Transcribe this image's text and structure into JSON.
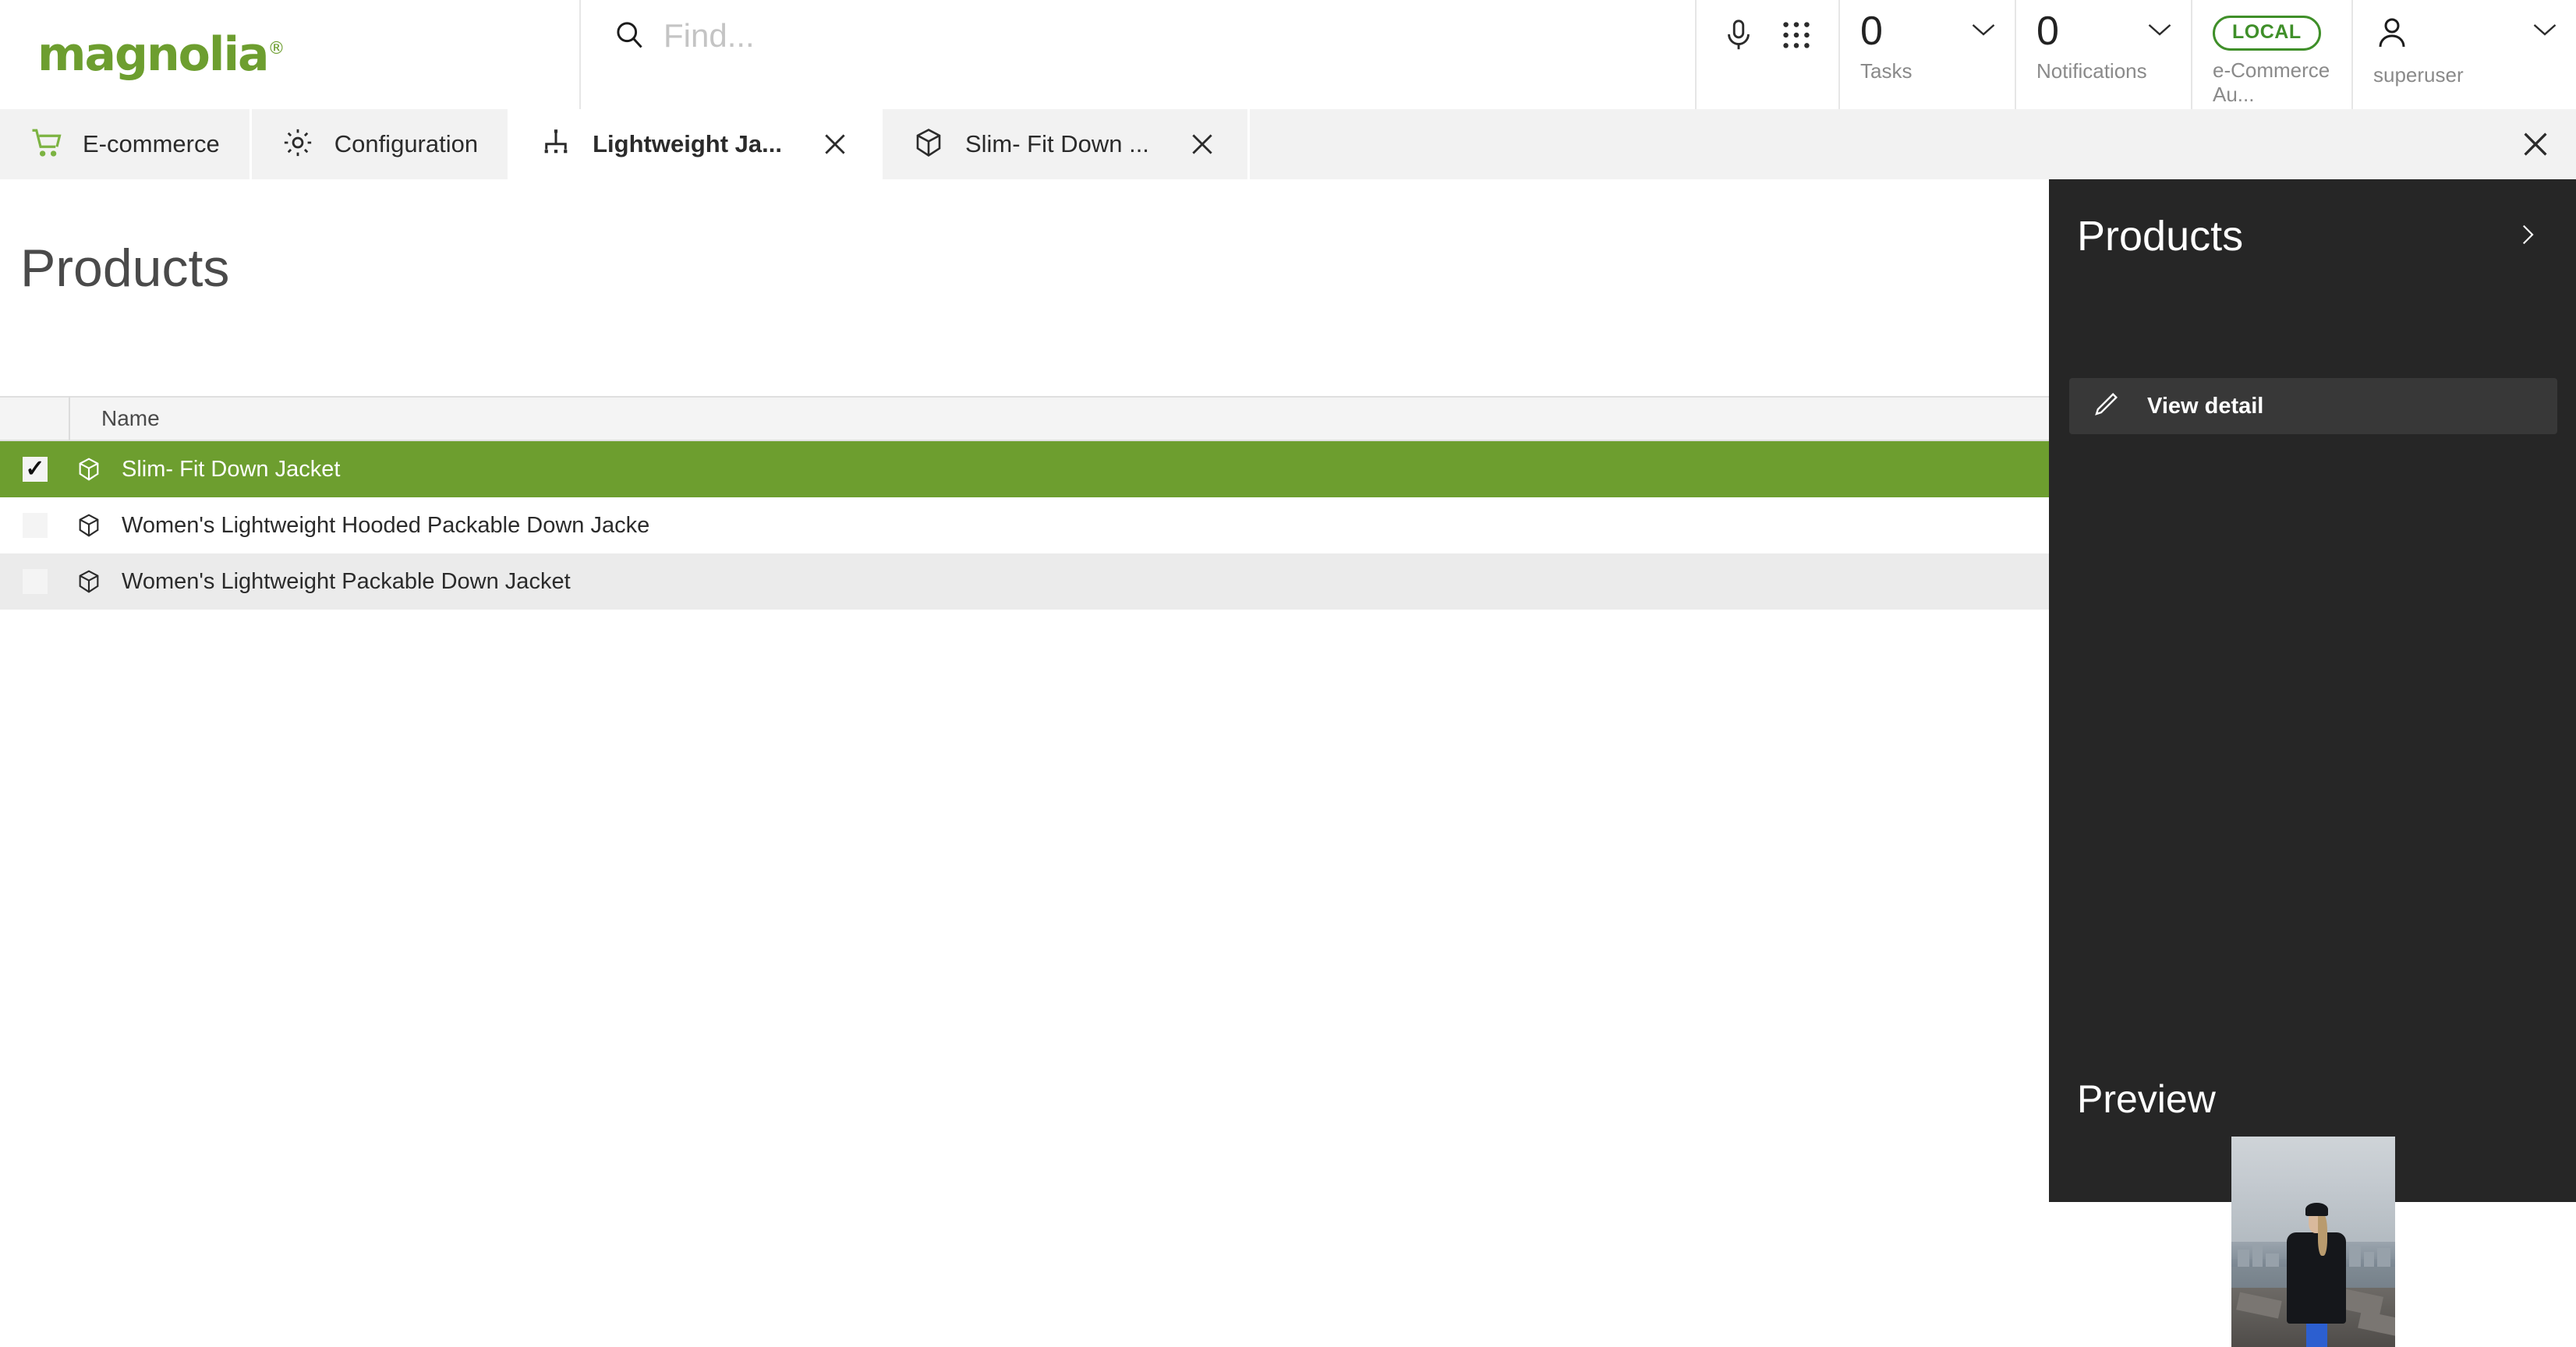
{
  "header": {
    "logo": {
      "text": "magnolia",
      "registered": "®",
      "color": "#6d9e2f"
    },
    "search": {
      "placeholder": "Find...",
      "value": "",
      "icon": "search-icon"
    },
    "icons": [
      {
        "name": "microphone-icon"
      },
      {
        "name": "apps-grid-icon"
      }
    ],
    "tasks": {
      "count": "0",
      "label": "Tasks"
    },
    "notifications": {
      "count": "0",
      "label": "Notifications"
    },
    "environment": {
      "badge": "LOCAL",
      "label": "e-Commerce Au...",
      "badge_color": "#3f8f29"
    },
    "user": {
      "name": "superuser",
      "icon": "user-icon"
    }
  },
  "tabs": {
    "items": [
      {
        "label": "E-commerce",
        "icon": "shopping-cart-icon",
        "active": false,
        "closable": false
      },
      {
        "label": "Configuration",
        "icon": "gear-icon",
        "active": false,
        "closable": false
      },
      {
        "label": "Lightweight Ja...",
        "icon": "hierarchy-icon",
        "active": true,
        "closable": true
      },
      {
        "label": "Slim- Fit Down ...",
        "icon": "cube-icon",
        "active": false,
        "closable": true
      }
    ],
    "close_all": "close-icon"
  },
  "main": {
    "title": "Products",
    "menu_button": "hamburger-menu-icon",
    "table": {
      "columns": [
        "Name"
      ],
      "rows": [
        {
          "name": "Slim- Fit Down Jacket",
          "icon": "cube-icon",
          "checked": true,
          "selected": true
        },
        {
          "name": "Women's Lightweight Hooded Packable Down Jacke",
          "icon": "cube-icon",
          "checked": false,
          "selected": false
        },
        {
          "name": "Women's Lightweight Packable Down Jacket",
          "icon": "cube-icon",
          "checked": false,
          "selected": false
        }
      ]
    }
  },
  "right_panel": {
    "title": "Products",
    "expand_icon": "chevron-right-icon",
    "actions": [
      {
        "label": "View detail",
        "icon": "pencil-icon"
      }
    ],
    "preview": {
      "title": "Preview",
      "image_alt": "Woman wearing black down jacket with city skyline"
    }
  },
  "colors": {
    "brand_green": "#6d9e2f",
    "selected_row": "#6d9e2f",
    "panel_dark": "#262626",
    "panel_action": "#383838",
    "tab_inactive": "#f2f2f2",
    "row_alt": "#ebebeb"
  }
}
